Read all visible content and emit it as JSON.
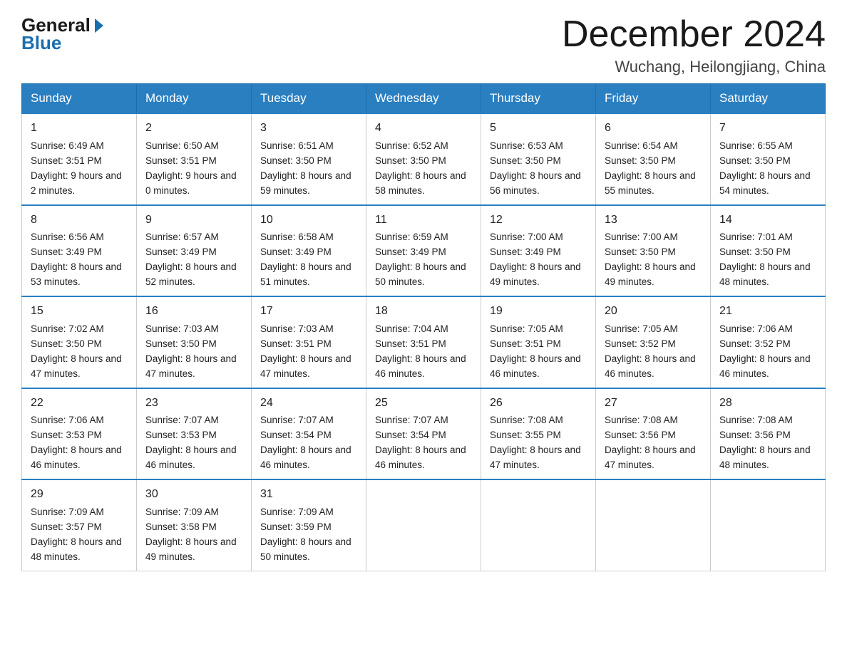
{
  "logo": {
    "general": "General",
    "blue": "Blue"
  },
  "title": "December 2024",
  "location": "Wuchang, Heilongjiang, China",
  "days_of_week": [
    "Sunday",
    "Monday",
    "Tuesday",
    "Wednesday",
    "Thursday",
    "Friday",
    "Saturday"
  ],
  "weeks": [
    [
      {
        "day": "1",
        "sunrise": "6:49 AM",
        "sunset": "3:51 PM",
        "daylight": "9 hours and 2 minutes."
      },
      {
        "day": "2",
        "sunrise": "6:50 AM",
        "sunset": "3:51 PM",
        "daylight": "9 hours and 0 minutes."
      },
      {
        "day": "3",
        "sunrise": "6:51 AM",
        "sunset": "3:50 PM",
        "daylight": "8 hours and 59 minutes."
      },
      {
        "day": "4",
        "sunrise": "6:52 AM",
        "sunset": "3:50 PM",
        "daylight": "8 hours and 58 minutes."
      },
      {
        "day": "5",
        "sunrise": "6:53 AM",
        "sunset": "3:50 PM",
        "daylight": "8 hours and 56 minutes."
      },
      {
        "day": "6",
        "sunrise": "6:54 AM",
        "sunset": "3:50 PM",
        "daylight": "8 hours and 55 minutes."
      },
      {
        "day": "7",
        "sunrise": "6:55 AM",
        "sunset": "3:50 PM",
        "daylight": "8 hours and 54 minutes."
      }
    ],
    [
      {
        "day": "8",
        "sunrise": "6:56 AM",
        "sunset": "3:49 PM",
        "daylight": "8 hours and 53 minutes."
      },
      {
        "day": "9",
        "sunrise": "6:57 AM",
        "sunset": "3:49 PM",
        "daylight": "8 hours and 52 minutes."
      },
      {
        "day": "10",
        "sunrise": "6:58 AM",
        "sunset": "3:49 PM",
        "daylight": "8 hours and 51 minutes."
      },
      {
        "day": "11",
        "sunrise": "6:59 AM",
        "sunset": "3:49 PM",
        "daylight": "8 hours and 50 minutes."
      },
      {
        "day": "12",
        "sunrise": "7:00 AM",
        "sunset": "3:49 PM",
        "daylight": "8 hours and 49 minutes."
      },
      {
        "day": "13",
        "sunrise": "7:00 AM",
        "sunset": "3:50 PM",
        "daylight": "8 hours and 49 minutes."
      },
      {
        "day": "14",
        "sunrise": "7:01 AM",
        "sunset": "3:50 PM",
        "daylight": "8 hours and 48 minutes."
      }
    ],
    [
      {
        "day": "15",
        "sunrise": "7:02 AM",
        "sunset": "3:50 PM",
        "daylight": "8 hours and 47 minutes."
      },
      {
        "day": "16",
        "sunrise": "7:03 AM",
        "sunset": "3:50 PM",
        "daylight": "8 hours and 47 minutes."
      },
      {
        "day": "17",
        "sunrise": "7:03 AM",
        "sunset": "3:51 PM",
        "daylight": "8 hours and 47 minutes."
      },
      {
        "day": "18",
        "sunrise": "7:04 AM",
        "sunset": "3:51 PM",
        "daylight": "8 hours and 46 minutes."
      },
      {
        "day": "19",
        "sunrise": "7:05 AM",
        "sunset": "3:51 PM",
        "daylight": "8 hours and 46 minutes."
      },
      {
        "day": "20",
        "sunrise": "7:05 AM",
        "sunset": "3:52 PM",
        "daylight": "8 hours and 46 minutes."
      },
      {
        "day": "21",
        "sunrise": "7:06 AM",
        "sunset": "3:52 PM",
        "daylight": "8 hours and 46 minutes."
      }
    ],
    [
      {
        "day": "22",
        "sunrise": "7:06 AM",
        "sunset": "3:53 PM",
        "daylight": "8 hours and 46 minutes."
      },
      {
        "day": "23",
        "sunrise": "7:07 AM",
        "sunset": "3:53 PM",
        "daylight": "8 hours and 46 minutes."
      },
      {
        "day": "24",
        "sunrise": "7:07 AM",
        "sunset": "3:54 PM",
        "daylight": "8 hours and 46 minutes."
      },
      {
        "day": "25",
        "sunrise": "7:07 AM",
        "sunset": "3:54 PM",
        "daylight": "8 hours and 46 minutes."
      },
      {
        "day": "26",
        "sunrise": "7:08 AM",
        "sunset": "3:55 PM",
        "daylight": "8 hours and 47 minutes."
      },
      {
        "day": "27",
        "sunrise": "7:08 AM",
        "sunset": "3:56 PM",
        "daylight": "8 hours and 47 minutes."
      },
      {
        "day": "28",
        "sunrise": "7:08 AM",
        "sunset": "3:56 PM",
        "daylight": "8 hours and 48 minutes."
      }
    ],
    [
      {
        "day": "29",
        "sunrise": "7:09 AM",
        "sunset": "3:57 PM",
        "daylight": "8 hours and 48 minutes."
      },
      {
        "day": "30",
        "sunrise": "7:09 AM",
        "sunset": "3:58 PM",
        "daylight": "8 hours and 49 minutes."
      },
      {
        "day": "31",
        "sunrise": "7:09 AM",
        "sunset": "3:59 PM",
        "daylight": "8 hours and 50 minutes."
      },
      null,
      null,
      null,
      null
    ]
  ]
}
